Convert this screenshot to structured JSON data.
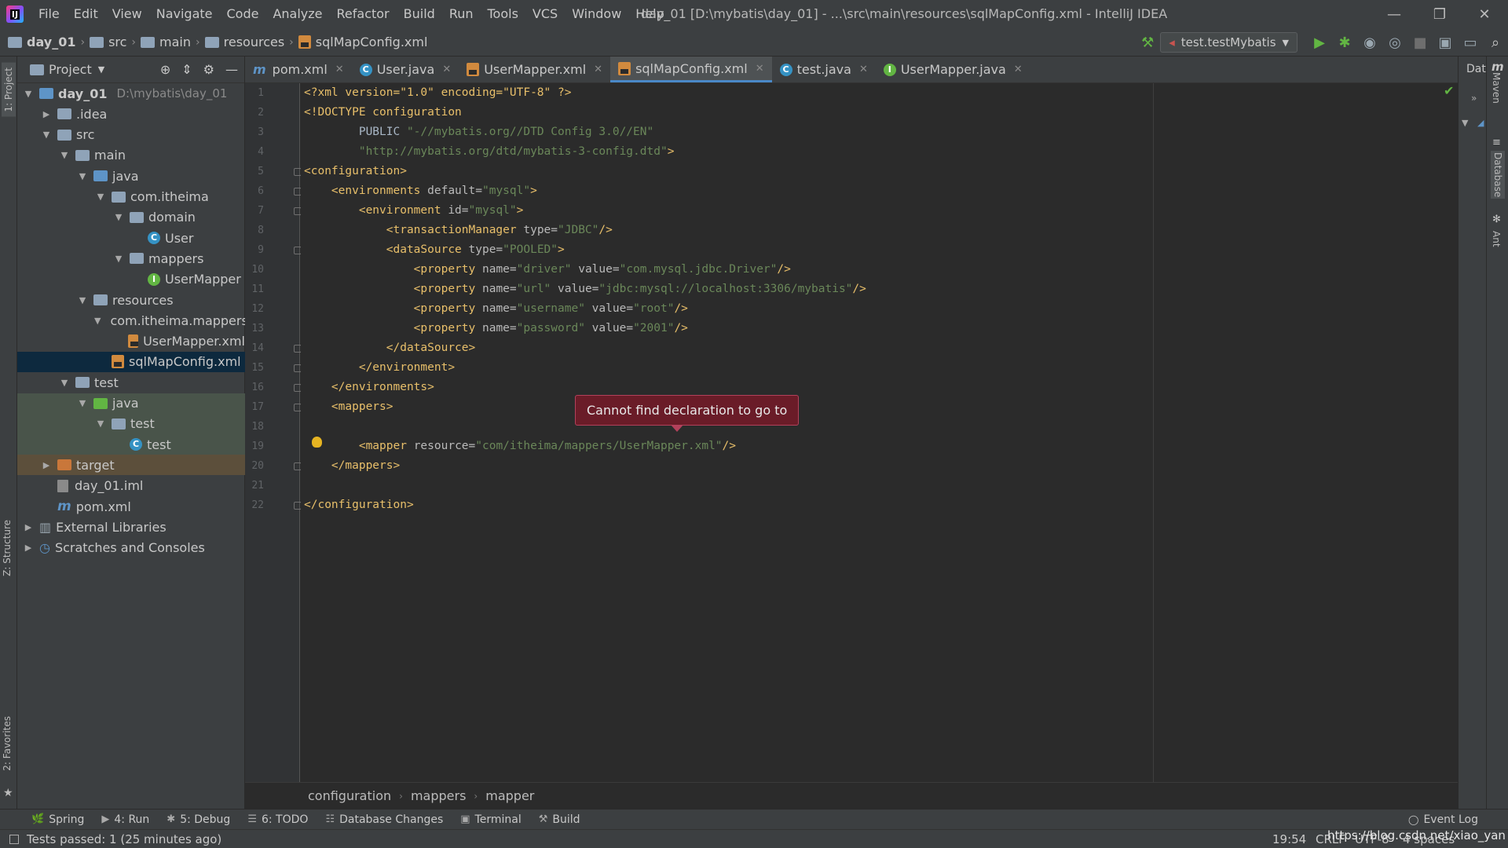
{
  "window": {
    "title": "day_01 [D:\\mybatis\\day_01] - ...\\src\\main\\resources\\sqlMapConfig.xml - IntelliJ IDEA",
    "menu": [
      "File",
      "Edit",
      "View",
      "Navigate",
      "Code",
      "Analyze",
      "Refactor",
      "Build",
      "Run",
      "Tools",
      "VCS",
      "Window",
      "Help"
    ]
  },
  "navbar": {
    "crumbs": [
      "day_01",
      "src",
      "main",
      "resources",
      "sqlMapConfig.xml"
    ],
    "run_config": "test.testMybatis"
  },
  "project": {
    "title": "Project",
    "tree": [
      {
        "label": "day_01",
        "extra": "D:\\mybatis\\day_01",
        "arrow": "▼",
        "icon": "module-folder"
      },
      {
        "label": ".idea",
        "arrow": "▶",
        "icon": "folder"
      },
      {
        "label": "src",
        "arrow": "▼",
        "icon": "folder"
      },
      {
        "label": "main",
        "arrow": "▼",
        "icon": "folder"
      },
      {
        "label": "java",
        "arrow": "▼",
        "icon": "source-folder"
      },
      {
        "label": "com.itheima",
        "arrow": "▼",
        "icon": "package"
      },
      {
        "label": "domain",
        "arrow": "▼",
        "icon": "package"
      },
      {
        "label": "User",
        "arrow": "",
        "icon": "class"
      },
      {
        "label": "mappers",
        "arrow": "▼",
        "icon": "package"
      },
      {
        "label": "UserMapper",
        "arrow": "",
        "icon": "interface"
      },
      {
        "label": "resources",
        "arrow": "▼",
        "icon": "resources-folder"
      },
      {
        "label": "com.itheima.mappers",
        "arrow": "▼",
        "icon": "package"
      },
      {
        "label": "UserMapper.xml",
        "arrow": "",
        "icon": "xml-file"
      },
      {
        "label": "sqlMapConfig.xml",
        "arrow": "",
        "icon": "xml-file"
      },
      {
        "label": "test",
        "arrow": "▼",
        "icon": "folder"
      },
      {
        "label": "java",
        "arrow": "▼",
        "icon": "test-source-folder"
      },
      {
        "label": "test",
        "arrow": "▼",
        "icon": "package"
      },
      {
        "label": "test",
        "arrow": "",
        "icon": "test-class"
      },
      {
        "label": "target",
        "arrow": "▶",
        "icon": "excluded-folder"
      },
      {
        "label": "day_01.iml",
        "arrow": "",
        "icon": "iml-file"
      },
      {
        "label": "pom.xml",
        "arrow": "",
        "icon": "maven-file"
      },
      {
        "label": "External Libraries",
        "arrow": "▶",
        "icon": "library"
      },
      {
        "label": "Scratches and Consoles",
        "arrow": "▶",
        "icon": "scratches"
      }
    ]
  },
  "tabs": [
    {
      "label": "pom.xml",
      "icon": "maven"
    },
    {
      "label": "User.java",
      "icon": "class"
    },
    {
      "label": "UserMapper.xml",
      "icon": "xml"
    },
    {
      "label": "sqlMapConfig.xml",
      "icon": "xml",
      "active": true
    },
    {
      "label": "test.java",
      "icon": "test-class"
    },
    {
      "label": "UserMapper.java",
      "icon": "interface"
    }
  ],
  "right_tabs": [
    "Data",
    "Maven",
    "Database",
    "Ant"
  ],
  "left_tabs": [
    "1: Project",
    "Z: Structure",
    "2: Favorites"
  ],
  "code_lines": [
    [
      [
        "pi",
        "<?xml version=\"1.0\" encoding=\"UTF-8\" ?>"
      ]
    ],
    [
      [
        "tg",
        "<!DOCTYPE configuration"
      ]
    ],
    [
      [
        "tx",
        "        PUBLIC "
      ],
      [
        "vl",
        "\"-//mybatis.org//DTD Config 3.0//EN\""
      ]
    ],
    [
      [
        "tx",
        "        "
      ],
      [
        "vl",
        "\"http://mybatis.org/dtd/mybatis-3-config.dtd\""
      ],
      [
        "tg",
        ">"
      ]
    ],
    [
      [
        "tg",
        "<configuration>"
      ]
    ],
    [
      [
        "tg",
        "    <environments "
      ],
      [
        "at",
        "default="
      ],
      [
        "vl",
        "\"mysql\""
      ],
      [
        "tg",
        ">"
      ]
    ],
    [
      [
        "tg",
        "        <environment "
      ],
      [
        "at",
        "id="
      ],
      [
        "vl",
        "\"mysql\""
      ],
      [
        "tg",
        ">"
      ]
    ],
    [
      [
        "tg",
        "            <transactionManager "
      ],
      [
        "at",
        "type="
      ],
      [
        "vl",
        "\"JDBC\""
      ],
      [
        "tg",
        "/>"
      ]
    ],
    [
      [
        "tg",
        "            <dataSource "
      ],
      [
        "at",
        "type="
      ],
      [
        "vl",
        "\"POOLED\""
      ],
      [
        "tg",
        ">"
      ]
    ],
    [
      [
        "tg",
        "                <property "
      ],
      [
        "at",
        "name="
      ],
      [
        "vl",
        "\"driver\""
      ],
      [
        "at",
        " value="
      ],
      [
        "vl",
        "\"com.mysql.jdbc.Driver\""
      ],
      [
        "tg",
        "/>"
      ]
    ],
    [
      [
        "tg",
        "                <property "
      ],
      [
        "at",
        "name="
      ],
      [
        "vl",
        "\"url\""
      ],
      [
        "at",
        " value="
      ],
      [
        "vl",
        "\"jdbc:mysql://localhost:3306/mybatis\""
      ],
      [
        "tg",
        "/>"
      ]
    ],
    [
      [
        "tg",
        "                <property "
      ],
      [
        "at",
        "name="
      ],
      [
        "vl",
        "\"username\""
      ],
      [
        "at",
        " value="
      ],
      [
        "vl",
        "\"root\""
      ],
      [
        "tg",
        "/>"
      ]
    ],
    [
      [
        "tg",
        "                <property "
      ],
      [
        "at",
        "name="
      ],
      [
        "vl",
        "\"password\""
      ],
      [
        "at",
        " value="
      ],
      [
        "vl",
        "\"2001\""
      ],
      [
        "tg",
        "/>"
      ]
    ],
    [
      [
        "tg",
        "            </dataSource>"
      ]
    ],
    [
      [
        "tg",
        "        </environment>"
      ]
    ],
    [
      [
        "tg",
        "    </environments>"
      ]
    ],
    [
      [
        "tg",
        "    <mappers>"
      ]
    ],
    [
      [
        "tx",
        ""
      ]
    ],
    [
      [
        "tg",
        "        <mapper "
      ],
      [
        "at",
        "resource="
      ],
      [
        "vl",
        "\"com/itheima/mappers/UserMapper.xml\""
      ],
      [
        "tg",
        "/>"
      ]
    ],
    [
      [
        "tg",
        "    </mappers>"
      ]
    ],
    [
      [
        "tx",
        ""
      ]
    ],
    [
      [
        "tg",
        "</configuration>"
      ]
    ]
  ],
  "tooltip": "Cannot find declaration to go to",
  "bottom_crumbs": [
    "configuration",
    "mappers",
    "mapper"
  ],
  "tool_windows": [
    "Spring",
    "4: Run",
    "5: Debug",
    "6: TODO",
    "Database Changes",
    "Terminal",
    "Build"
  ],
  "event_log": "Event Log",
  "status": {
    "message": "Tests passed: 1 (25 minutes ago)",
    "position": "19:54",
    "line_sep": "CRLF",
    "encoding": "UTF-8",
    "indent": "4 spaces",
    "watermark": "https://blog.csdn.net/xiao_yan"
  }
}
